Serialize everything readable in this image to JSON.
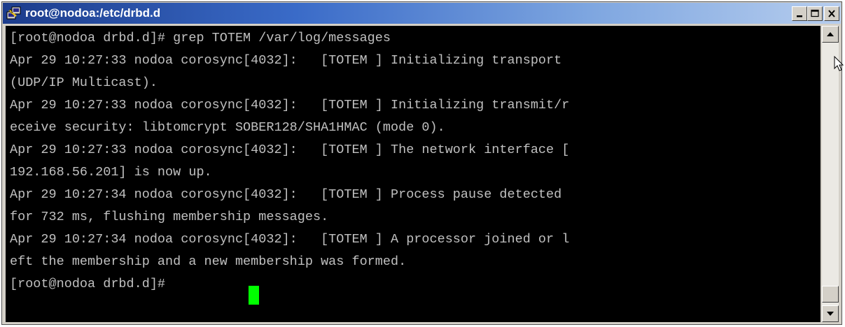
{
  "window": {
    "title": "root@nodoa:/etc/drbd.d",
    "app_icon": "putty-icon",
    "controls": {
      "minimize_icon": "minimize-icon",
      "maximize_icon": "maximize-icon",
      "close_icon": "close-icon"
    }
  },
  "terminal": {
    "lines": [
      "[root@nodoa drbd.d]# grep TOTEM /var/log/messages",
      "Apr 29 10:27:33 nodoa corosync[4032]:   [TOTEM ] Initializing transport",
      "(UDP/IP Multicast).",
      "Apr 29 10:27:33 nodoa corosync[4032]:   [TOTEM ] Initializing transmit/r",
      "eceive security: libtomcrypt SOBER128/SHA1HMAC (mode 0).",
      "Apr 29 10:27:33 nodoa corosync[4032]:   [TOTEM ] The network interface [",
      "192.168.56.201] is now up.",
      "Apr 29 10:27:34 nodoa corosync[4032]:   [TOTEM ] Process pause detected",
      "for 732 ms, flushing membership messages.",
      "Apr 29 10:27:34 nodoa corosync[4032]:   [TOTEM ] A processor joined or l",
      "eft the membership and a new membership was formed.",
      "[root@nodoa drbd.d]# "
    ],
    "text_color": "#c0c0c0",
    "background_color": "#000000",
    "cursor_color": "#00ff00"
  },
  "scrollbar": {
    "up_icon": "scroll-up-arrow-icon",
    "down_icon": "scroll-down-arrow-icon"
  },
  "colors": {
    "titlebar_start": "#1c3c8c",
    "titlebar_end": "#b6cdee",
    "chrome": "#d4d0c8"
  }
}
